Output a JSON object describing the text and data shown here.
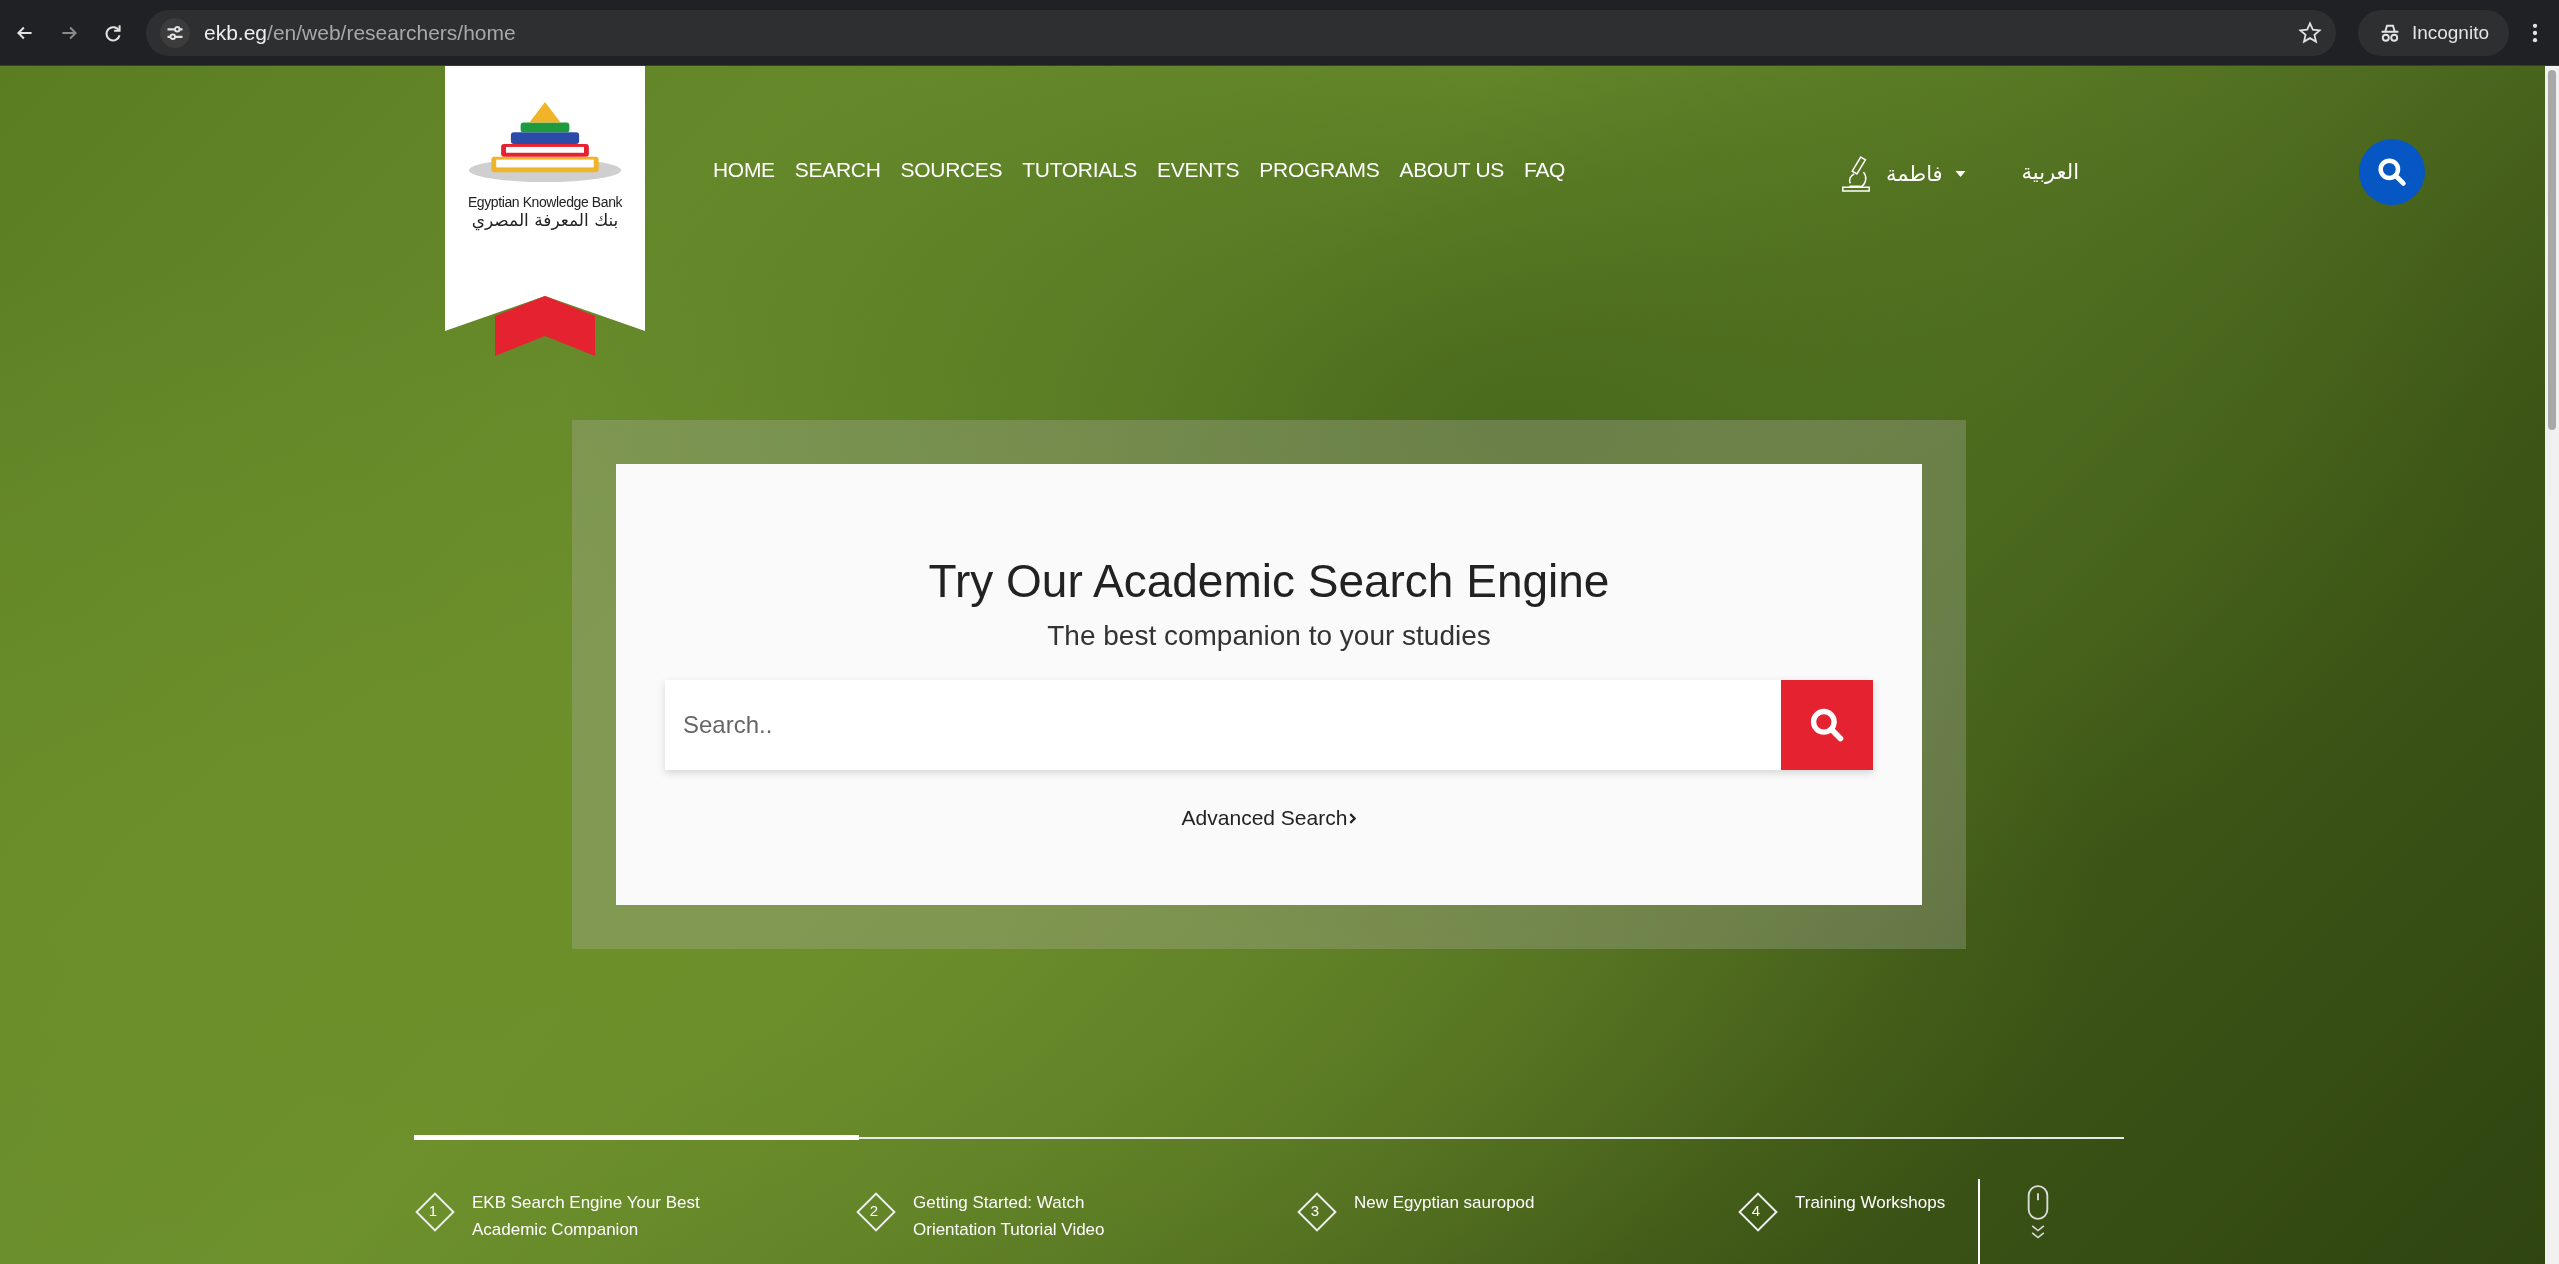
{
  "browser": {
    "url_host": "ekb.eg",
    "url_path": "/en/web/researchers/home",
    "profile": "Incognito"
  },
  "logo": {
    "name_en": "Egyptian Knowledge Bank",
    "name_ar": "بنك المعرفة المصري"
  },
  "nav": [
    {
      "label": "HOME"
    },
    {
      "label": "SEARCH"
    },
    {
      "label": "SOURCES"
    },
    {
      "label": "TUTORIALS"
    },
    {
      "label": "EVENTS"
    },
    {
      "label": "PROGRAMS"
    },
    {
      "label": "ABOUT US"
    },
    {
      "label": "FAQ"
    }
  ],
  "user": {
    "name": "فاطمة"
  },
  "language": "العربية",
  "search_card": {
    "title": "Try Our Academic Search Engine",
    "subtitle": "The best companion to your studies",
    "placeholder": "Search..",
    "advanced_link": "Advanced Search"
  },
  "slides": {
    "level": 0.26,
    "items": [
      {
        "number": "1",
        "title": "EKB Search Engine Your Best Academic Companion"
      },
      {
        "number": "2",
        "title": "Getting Started: Watch Orientation Tutorial Video"
      },
      {
        "number": "3",
        "title": "New Egyptian sauropod"
      },
      {
        "number": "4",
        "title": "Training Workshops"
      }
    ]
  }
}
